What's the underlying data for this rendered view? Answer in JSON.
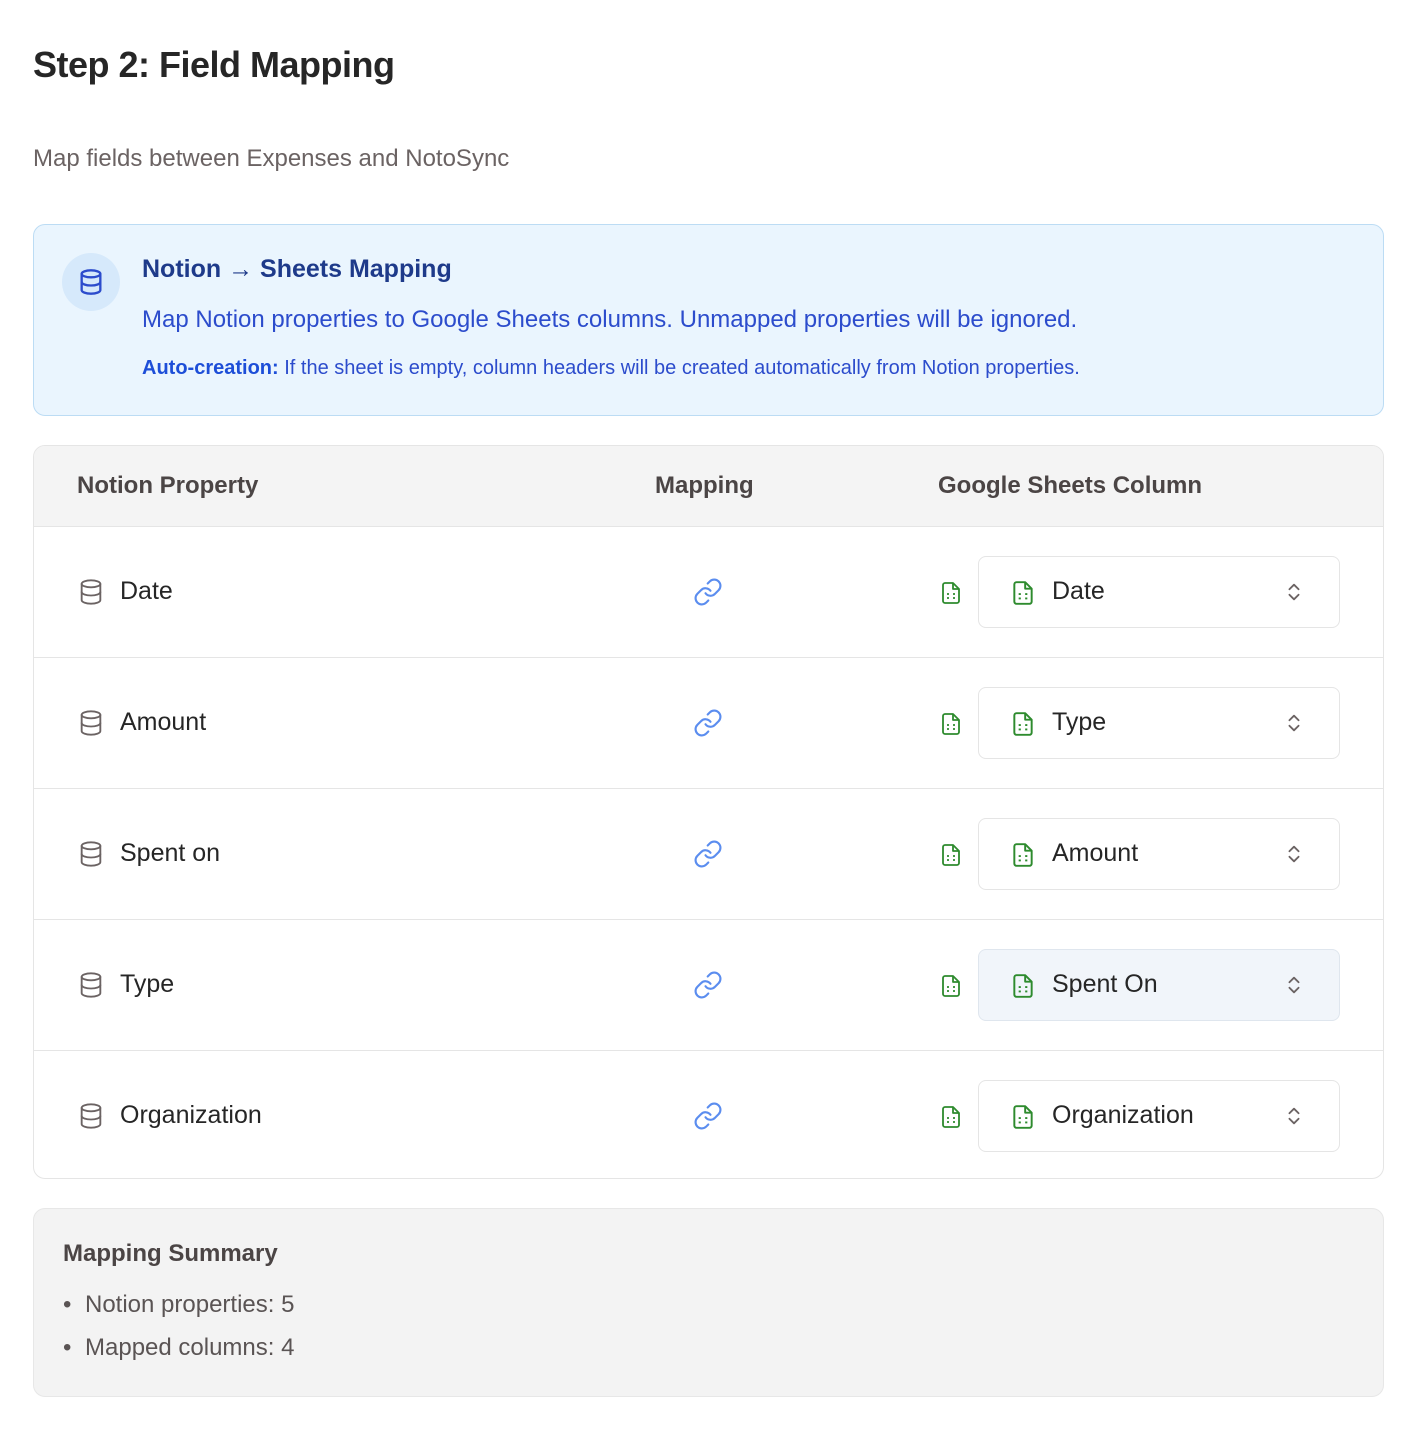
{
  "header": {
    "title": "Step 2: Field Mapping",
    "subtitle": "Map fields between Expenses and NotoSync"
  },
  "info": {
    "icon": "database-icon",
    "title": "Notion → Sheets Mapping",
    "text": "Map Notion properties to Google Sheets columns. Unmapped properties will be ignored.",
    "note_label": "Auto-creation:",
    "note_text": " If the sheet is empty, column headers will be created automatically from Notion properties."
  },
  "table": {
    "headers": {
      "property": "Notion Property",
      "mapping": "Mapping",
      "column": "Google Sheets Column"
    },
    "rows": [
      {
        "property": "Date",
        "column": "Date"
      },
      {
        "property": "Amount",
        "column": "Type"
      },
      {
        "property": "Spent on",
        "column": "Amount"
      },
      {
        "property": "Type",
        "column": "Spent On"
      },
      {
        "property": "Organization",
        "column": "Organization"
      }
    ]
  },
  "summary": {
    "title": "Mapping Summary",
    "items": [
      "Notion properties: 5",
      "Mapped columns: 4"
    ]
  },
  "colors": {
    "accent_blue": "#2c4ccc",
    "link_blue": "#5b8def",
    "sheets_green": "#2e8b2e"
  }
}
